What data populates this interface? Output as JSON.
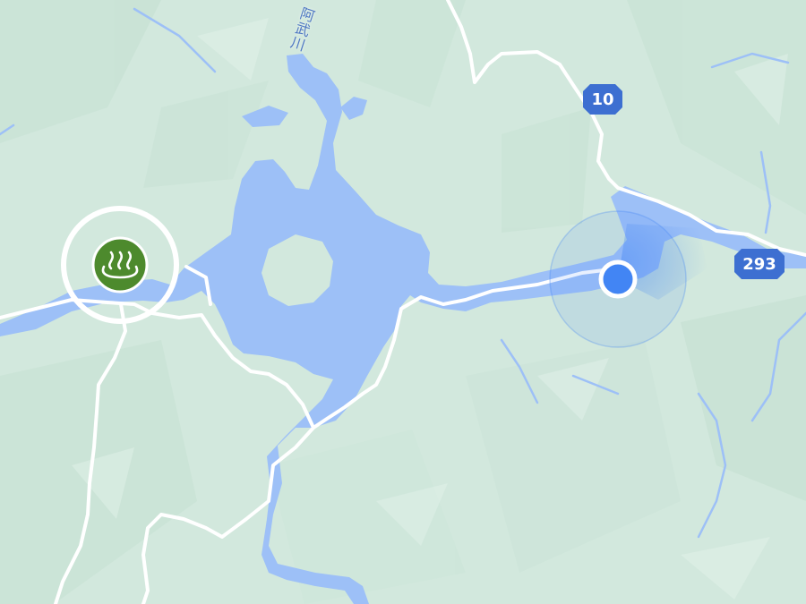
{
  "map": {
    "colors": {
      "land": "#cfe6dc",
      "water": "#9dc0f7",
      "road": "#ffffff",
      "shield": "#3d6fd1",
      "onsen_pin": "#4d8a2d",
      "location": "#4285f4"
    },
    "river_label": "阿武川",
    "route_shields": [
      {
        "id": "route-10",
        "label": "10"
      },
      {
        "id": "route-293",
        "label": "293"
      }
    ],
    "poi": {
      "type": "hot-spring",
      "icon": "hot-spring-icon",
      "selected": true
    },
    "user_location": {
      "icon": "my-location-dot"
    }
  }
}
